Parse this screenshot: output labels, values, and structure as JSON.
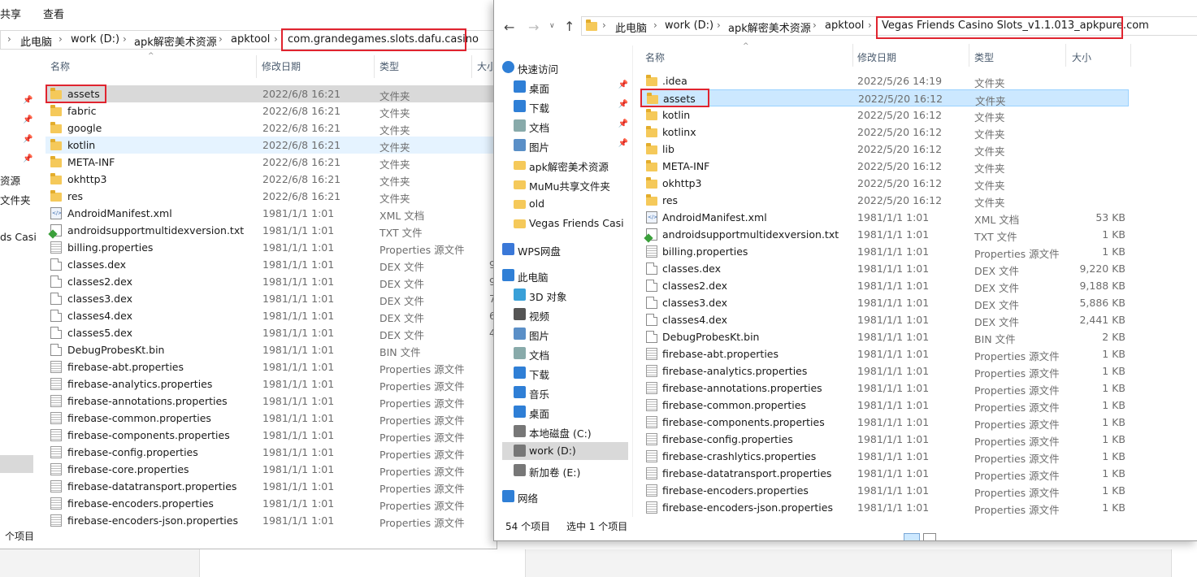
{
  "left_window": {
    "ribbon_tabs": [
      "共享",
      "查看"
    ],
    "breadcrumb": [
      "此电脑",
      "work (D:)",
      "apk解密美术资源",
      "apktool",
      "com.grandegames.slots.dafu.casino"
    ],
    "columns": {
      "name": "名称",
      "date": "修改日期",
      "type": "类型",
      "size": "大小"
    },
    "nav_fragments": [
      "资源",
      "文件夹",
      "ds Casi"
    ],
    "files": [
      {
        "name": "assets",
        "date": "2022/6/8 16:21",
        "type": "文件夹",
        "size": "",
        "icon": "folder"
      },
      {
        "name": "fabric",
        "date": "2022/6/8 16:21",
        "type": "文件夹",
        "size": "",
        "icon": "folder"
      },
      {
        "name": "google",
        "date": "2022/6/8 16:21",
        "type": "文件夹",
        "size": "",
        "icon": "folder"
      },
      {
        "name": "kotlin",
        "date": "2022/6/8 16:21",
        "type": "文件夹",
        "size": "",
        "icon": "folder"
      },
      {
        "name": "META-INF",
        "date": "2022/6/8 16:21",
        "type": "文件夹",
        "size": "",
        "icon": "folder"
      },
      {
        "name": "okhttp3",
        "date": "2022/6/8 16:21",
        "type": "文件夹",
        "size": "",
        "icon": "folder"
      },
      {
        "name": "res",
        "date": "2022/6/8 16:21",
        "type": "文件夹",
        "size": "",
        "icon": "folder"
      },
      {
        "name": "AndroidManifest.xml",
        "date": "1981/1/1 1:01",
        "type": "XML 文档",
        "size": "",
        "icon": "xml"
      },
      {
        "name": "androidsupportmultidexversion.txt",
        "date": "1981/1/1 1:01",
        "type": "TXT 文件",
        "size": "",
        "icon": "txt"
      },
      {
        "name": "billing.properties",
        "date": "1981/1/1 1:01",
        "type": "Properties 源文件",
        "size": "",
        "icon": "prop"
      },
      {
        "name": "classes.dex",
        "date": "1981/1/1 1:01",
        "type": "DEX 文件",
        "size": "9",
        "icon": "doc"
      },
      {
        "name": "classes2.dex",
        "date": "1981/1/1 1:01",
        "type": "DEX 文件",
        "size": "9",
        "icon": "doc"
      },
      {
        "name": "classes3.dex",
        "date": "1981/1/1 1:01",
        "type": "DEX 文件",
        "size": "7",
        "icon": "doc"
      },
      {
        "name": "classes4.dex",
        "date": "1981/1/1 1:01",
        "type": "DEX 文件",
        "size": "6",
        "icon": "doc"
      },
      {
        "name": "classes5.dex",
        "date": "1981/1/1 1:01",
        "type": "DEX 文件",
        "size": "4",
        "icon": "doc"
      },
      {
        "name": "DebugProbesKt.bin",
        "date": "1981/1/1 1:01",
        "type": "BIN 文件",
        "size": "",
        "icon": "doc"
      },
      {
        "name": "firebase-abt.properties",
        "date": "1981/1/1 1:01",
        "type": "Properties 源文件",
        "size": "",
        "icon": "prop"
      },
      {
        "name": "firebase-analytics.properties",
        "date": "1981/1/1 1:01",
        "type": "Properties 源文件",
        "size": "",
        "icon": "prop"
      },
      {
        "name": "firebase-annotations.properties",
        "date": "1981/1/1 1:01",
        "type": "Properties 源文件",
        "size": "",
        "icon": "prop"
      },
      {
        "name": "firebase-common.properties",
        "date": "1981/1/1 1:01",
        "type": "Properties 源文件",
        "size": "",
        "icon": "prop"
      },
      {
        "name": "firebase-components.properties",
        "date": "1981/1/1 1:01",
        "type": "Properties 源文件",
        "size": "",
        "icon": "prop"
      },
      {
        "name": "firebase-config.properties",
        "date": "1981/1/1 1:01",
        "type": "Properties 源文件",
        "size": "",
        "icon": "prop"
      },
      {
        "name": "firebase-core.properties",
        "date": "1981/1/1 1:01",
        "type": "Properties 源文件",
        "size": "",
        "icon": "prop"
      },
      {
        "name": "firebase-datatransport.properties",
        "date": "1981/1/1 1:01",
        "type": "Properties 源文件",
        "size": "",
        "icon": "prop"
      },
      {
        "name": "firebase-encoders.properties",
        "date": "1981/1/1 1:01",
        "type": "Properties 源文件",
        "size": "",
        "icon": "prop"
      },
      {
        "name": "firebase-encoders-json.properties",
        "date": "1981/1/1 1:01",
        "type": "Properties 源文件",
        "size": "",
        "icon": "prop"
      }
    ],
    "status": "个项目"
  },
  "right_window": {
    "breadcrumb": [
      "此电脑",
      "work (D:)",
      "apk解密美术资源",
      "apktool",
      "Vegas Friends Casino Slots_v1.1.013_apkpure.com"
    ],
    "columns": {
      "name": "名称",
      "date": "修改日期",
      "type": "类型",
      "size": "大小"
    },
    "nav": [
      {
        "label": "快速访问",
        "icon": "star-icon",
        "pinned": false
      },
      {
        "label": "桌面",
        "icon": "desktop-icon",
        "pinned": true
      },
      {
        "label": "下载",
        "icon": "download-icon",
        "pinned": true
      },
      {
        "label": "文档",
        "icon": "document-icon",
        "pinned": true
      },
      {
        "label": "图片",
        "icon": "picture-icon",
        "pinned": true
      },
      {
        "label": "apk解密美术资源",
        "icon": "folder-icon",
        "pinned": false
      },
      {
        "label": "MuMu共享文件夹",
        "icon": "folder-icon",
        "pinned": false
      },
      {
        "label": "old",
        "icon": "folder-icon",
        "pinned": false
      },
      {
        "label": "Vegas Friends Casi",
        "icon": "folder-icon",
        "pinned": false
      },
      {
        "label": "WPS网盘",
        "icon": "cloud-icon",
        "pinned": false
      },
      {
        "label": "此电脑",
        "icon": "computer-icon",
        "pinned": false
      },
      {
        "label": "3D 对象",
        "icon": "3d-objects-icon",
        "pinned": false
      },
      {
        "label": "视频",
        "icon": "video-icon",
        "pinned": false
      },
      {
        "label": "图片",
        "icon": "picture-icon",
        "pinned": false
      },
      {
        "label": "文档",
        "icon": "document-icon",
        "pinned": false
      },
      {
        "label": "下载",
        "icon": "download-icon",
        "pinned": false
      },
      {
        "label": "音乐",
        "icon": "music-icon",
        "pinned": false
      },
      {
        "label": "桌面",
        "icon": "desktop-icon",
        "pinned": false
      },
      {
        "label": "本地磁盘 (C:)",
        "icon": "drive-icon",
        "pinned": false
      },
      {
        "label": "work (D:)",
        "icon": "drive-icon",
        "pinned": false
      },
      {
        "label": "新加卷 (E:)",
        "icon": "drive-icon",
        "pinned": false
      },
      {
        "label": "网络",
        "icon": "network-icon",
        "pinned": false
      }
    ],
    "files": [
      {
        "name": ".idea",
        "date": "2022/5/26 14:19",
        "type": "文件夹",
        "size": "",
        "icon": "folder"
      },
      {
        "name": "assets",
        "date": "2022/5/20 16:12",
        "type": "文件夹",
        "size": "",
        "icon": "folder"
      },
      {
        "name": "kotlin",
        "date": "2022/5/20 16:12",
        "type": "文件夹",
        "size": "",
        "icon": "folder"
      },
      {
        "name": "kotlinx",
        "date": "2022/5/20 16:12",
        "type": "文件夹",
        "size": "",
        "icon": "folder"
      },
      {
        "name": "lib",
        "date": "2022/5/20 16:12",
        "type": "文件夹",
        "size": "",
        "icon": "folder"
      },
      {
        "name": "META-INF",
        "date": "2022/5/20 16:12",
        "type": "文件夹",
        "size": "",
        "icon": "folder"
      },
      {
        "name": "okhttp3",
        "date": "2022/5/20 16:12",
        "type": "文件夹",
        "size": "",
        "icon": "folder"
      },
      {
        "name": "res",
        "date": "2022/5/20 16:12",
        "type": "文件夹",
        "size": "",
        "icon": "folder"
      },
      {
        "name": "AndroidManifest.xml",
        "date": "1981/1/1 1:01",
        "type": "XML 文档",
        "size": "53 KB",
        "icon": "xml"
      },
      {
        "name": "androidsupportmultidexversion.txt",
        "date": "1981/1/1 1:01",
        "type": "TXT 文件",
        "size": "1 KB",
        "icon": "txt"
      },
      {
        "name": "billing.properties",
        "date": "1981/1/1 1:01",
        "type": "Properties 源文件",
        "size": "1 KB",
        "icon": "prop"
      },
      {
        "name": "classes.dex",
        "date": "1981/1/1 1:01",
        "type": "DEX 文件",
        "size": "9,220 KB",
        "icon": "doc"
      },
      {
        "name": "classes2.dex",
        "date": "1981/1/1 1:01",
        "type": "DEX 文件",
        "size": "9,188 KB",
        "icon": "doc"
      },
      {
        "name": "classes3.dex",
        "date": "1981/1/1 1:01",
        "type": "DEX 文件",
        "size": "5,886 KB",
        "icon": "doc"
      },
      {
        "name": "classes4.dex",
        "date": "1981/1/1 1:01",
        "type": "DEX 文件",
        "size": "2,441 KB",
        "icon": "doc"
      },
      {
        "name": "DebugProbesKt.bin",
        "date": "1981/1/1 1:01",
        "type": "BIN 文件",
        "size": "2 KB",
        "icon": "doc"
      },
      {
        "name": "firebase-abt.properties",
        "date": "1981/1/1 1:01",
        "type": "Properties 源文件",
        "size": "1 KB",
        "icon": "prop"
      },
      {
        "name": "firebase-analytics.properties",
        "date": "1981/1/1 1:01",
        "type": "Properties 源文件",
        "size": "1 KB",
        "icon": "prop"
      },
      {
        "name": "firebase-annotations.properties",
        "date": "1981/1/1 1:01",
        "type": "Properties 源文件",
        "size": "1 KB",
        "icon": "prop"
      },
      {
        "name": "firebase-common.properties",
        "date": "1981/1/1 1:01",
        "type": "Properties 源文件",
        "size": "1 KB",
        "icon": "prop"
      },
      {
        "name": "firebase-components.properties",
        "date": "1981/1/1 1:01",
        "type": "Properties 源文件",
        "size": "1 KB",
        "icon": "prop"
      },
      {
        "name": "firebase-config.properties",
        "date": "1981/1/1 1:01",
        "type": "Properties 源文件",
        "size": "1 KB",
        "icon": "prop"
      },
      {
        "name": "firebase-crashlytics.properties",
        "date": "1981/1/1 1:01",
        "type": "Properties 源文件",
        "size": "1 KB",
        "icon": "prop"
      },
      {
        "name": "firebase-datatransport.properties",
        "date": "1981/1/1 1:01",
        "type": "Properties 源文件",
        "size": "1 KB",
        "icon": "prop"
      },
      {
        "name": "firebase-encoders.properties",
        "date": "1981/1/1 1:01",
        "type": "Properties 源文件",
        "size": "1 KB",
        "icon": "prop"
      },
      {
        "name": "firebase-encoders-json.properties",
        "date": "1981/1/1 1:01",
        "type": "Properties 源文件",
        "size": "1 KB",
        "icon": "prop"
      }
    ],
    "status_count": "54 个项目",
    "status_selected": "选中 1 个项目"
  },
  "colors": {
    "highlight": "#e0242f",
    "selected": "#cce8ff",
    "hover": "#e5f3ff",
    "grey_select": "#d9d9d9"
  }
}
